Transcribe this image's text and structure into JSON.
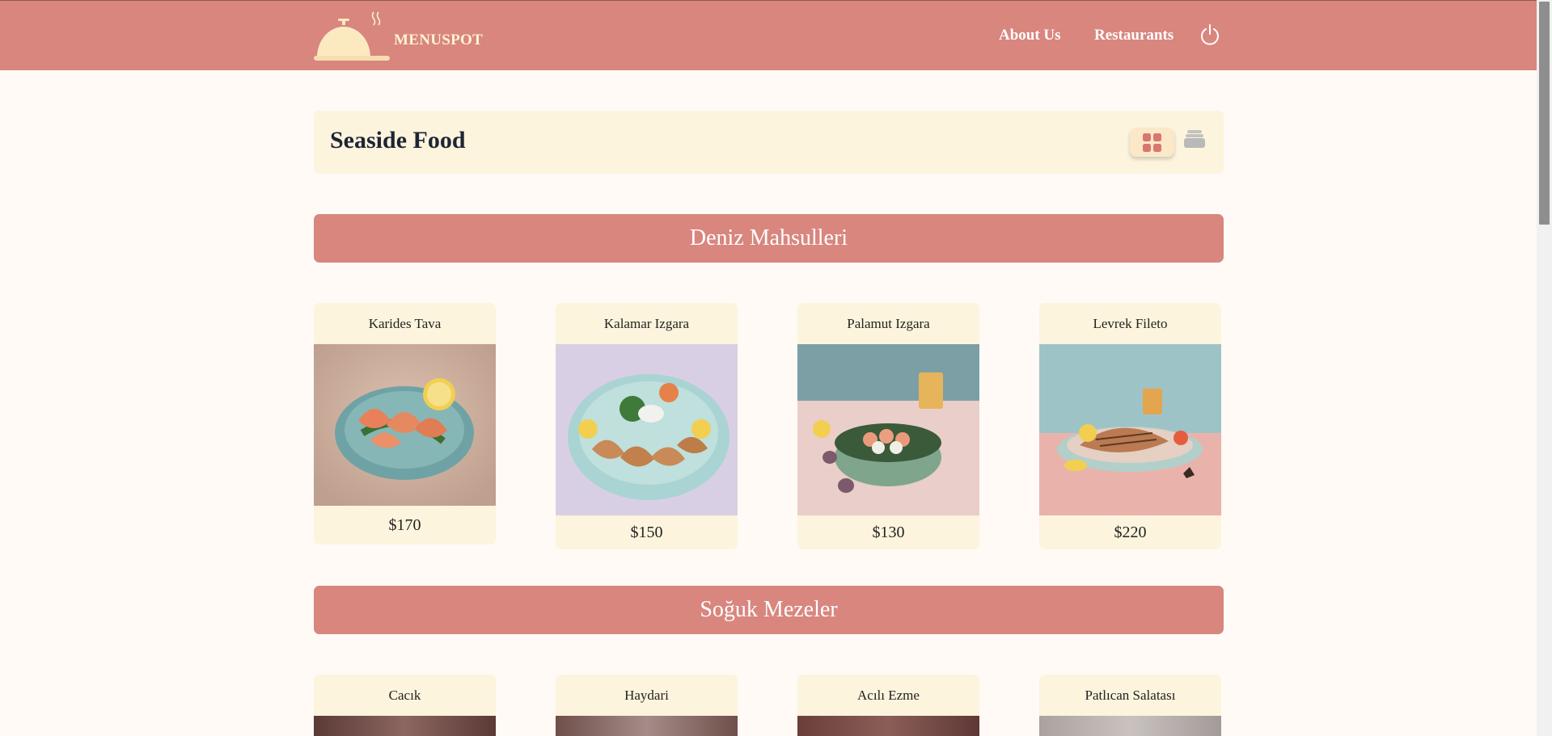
{
  "header": {
    "brand": "MENUSPOT",
    "nav": {
      "about": "About Us",
      "restaurants": "Restaurants"
    }
  },
  "page": {
    "title": "Seaside Food"
  },
  "sections": [
    {
      "title": "Deniz Mahsulleri",
      "items": [
        {
          "name": "Karides Tava",
          "price": "$170"
        },
        {
          "name": "Kalamar Izgara",
          "price": "$150"
        },
        {
          "name": "Palamut Izgara",
          "price": "$130"
        },
        {
          "name": "Levrek Fileto",
          "price": "$220"
        }
      ]
    },
    {
      "title": "Soğuk Mezeler",
      "items": [
        {
          "name": "Cacık"
        },
        {
          "name": "Haydari"
        },
        {
          "name": "Acılı Ezme"
        },
        {
          "name": "Patlıcan Salatası"
        }
      ]
    }
  ],
  "colors": {
    "header_bg": "#d8867e",
    "page_bg": "#fffaf6",
    "card_bg": "#fcf4dc",
    "title_text": "#1e2535",
    "section_bg": "#d8867e"
  },
  "icons": {
    "logo": "cloche-icon",
    "power": "power-icon",
    "grid_view": "grid-view-icon",
    "list_view": "stack-view-icon"
  }
}
